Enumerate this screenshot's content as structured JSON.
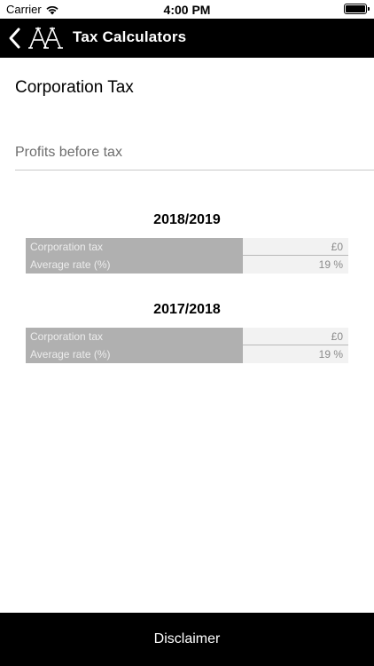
{
  "status_bar": {
    "carrier": "Carrier",
    "time": "4:00 PM",
    "wifi_icon": "wifi-icon",
    "battery_icon": "battery-icon"
  },
  "nav": {
    "title": "Tax Calculators",
    "back_icon": "chevron-left-icon",
    "logo": "AA"
  },
  "page": {
    "title": "Corporation Tax"
  },
  "input": {
    "placeholder": "Profits before tax",
    "value": ""
  },
  "results": [
    {
      "year": "2018/2019",
      "rows": [
        {
          "label": "Corporation tax",
          "value": "£0"
        },
        {
          "label": "Average rate (%)",
          "value": "19 %"
        }
      ]
    },
    {
      "year": "2017/2018",
      "rows": [
        {
          "label": "Corporation tax",
          "value": "£0"
        },
        {
          "label": "Average rate (%)",
          "value": "19 %"
        }
      ]
    }
  ],
  "footer": {
    "disclaimer_label": "Disclaimer"
  },
  "colors": {
    "bar_background": "#000000",
    "label_cell": "#b0b0b0",
    "value_cell": "#f2f2f2"
  }
}
